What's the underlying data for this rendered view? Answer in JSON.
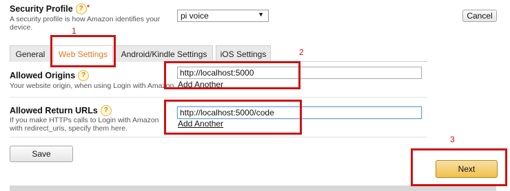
{
  "security_profile": {
    "label": "Security Profile",
    "help": "?",
    "required_mark": "*",
    "description": "A security profile is how Amazon identifies your device.",
    "selected": "pi voice",
    "caret": "▼"
  },
  "cancel_label": "Cancel",
  "tabs": [
    {
      "label": "General",
      "active": false
    },
    {
      "label": "Web Settings",
      "active": true
    },
    {
      "label": "Android/Kindle Settings",
      "active": false
    },
    {
      "label": "iOS Settings",
      "active": false
    }
  ],
  "allowed_origins": {
    "label": "Allowed Origins",
    "help": "?",
    "description": "Your website origin, when using Login with Amazon",
    "value": "http://localhost:5000",
    "add_another": "Add Another"
  },
  "allowed_return_urls": {
    "label": "Allowed Return URLs",
    "help": "?",
    "description": "If you make HTTPs calls to Login with Amazon with redirect_uris, specify them here.",
    "value": "http://localhost:5000/code",
    "add_another": "Add Another"
  },
  "save_label": "Save",
  "next_label": "Next",
  "annotations": [
    "1",
    "2",
    "3"
  ],
  "colors": {
    "annotation_red": "#d01010",
    "active_tab_orange": "#e4791f",
    "next_button": "#f0c14b"
  }
}
